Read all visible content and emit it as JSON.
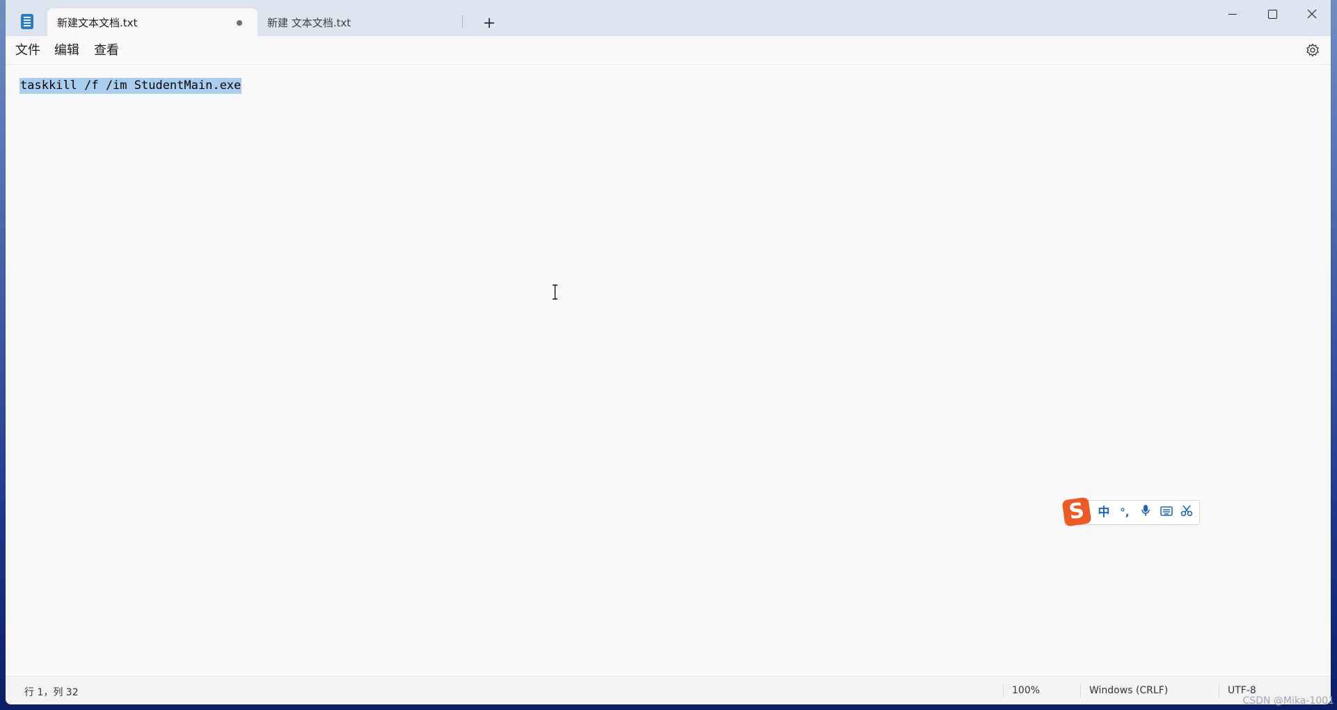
{
  "tabs": [
    {
      "label": "新建文本文档.txt",
      "modified": true
    },
    {
      "label": "新建 文本文档.txt"
    }
  ],
  "window_controls": {
    "minimize": "minimize-icon",
    "maximize": "maximize-icon",
    "close": "close-icon"
  },
  "menu": {
    "file": "文件",
    "edit": "编辑",
    "view": "查看"
  },
  "editor": {
    "content": "taskkill /f /im StudentMain.exe",
    "selected": true
  },
  "ime": {
    "mode": "中",
    "punct": "°,",
    "icons": [
      "mic-icon",
      "keyboard-icon",
      "scissors-icon"
    ]
  },
  "status": {
    "position": "行 1，列 32",
    "zoom": "100%",
    "line_ending": "Windows (CRLF)",
    "encoding": "UTF-8"
  },
  "watermark": "CSDN @Mika-1001",
  "colors": {
    "selection": "#a9cdef",
    "ime_accent": "#1d66c4",
    "ime_logo": "#ef5a24"
  }
}
